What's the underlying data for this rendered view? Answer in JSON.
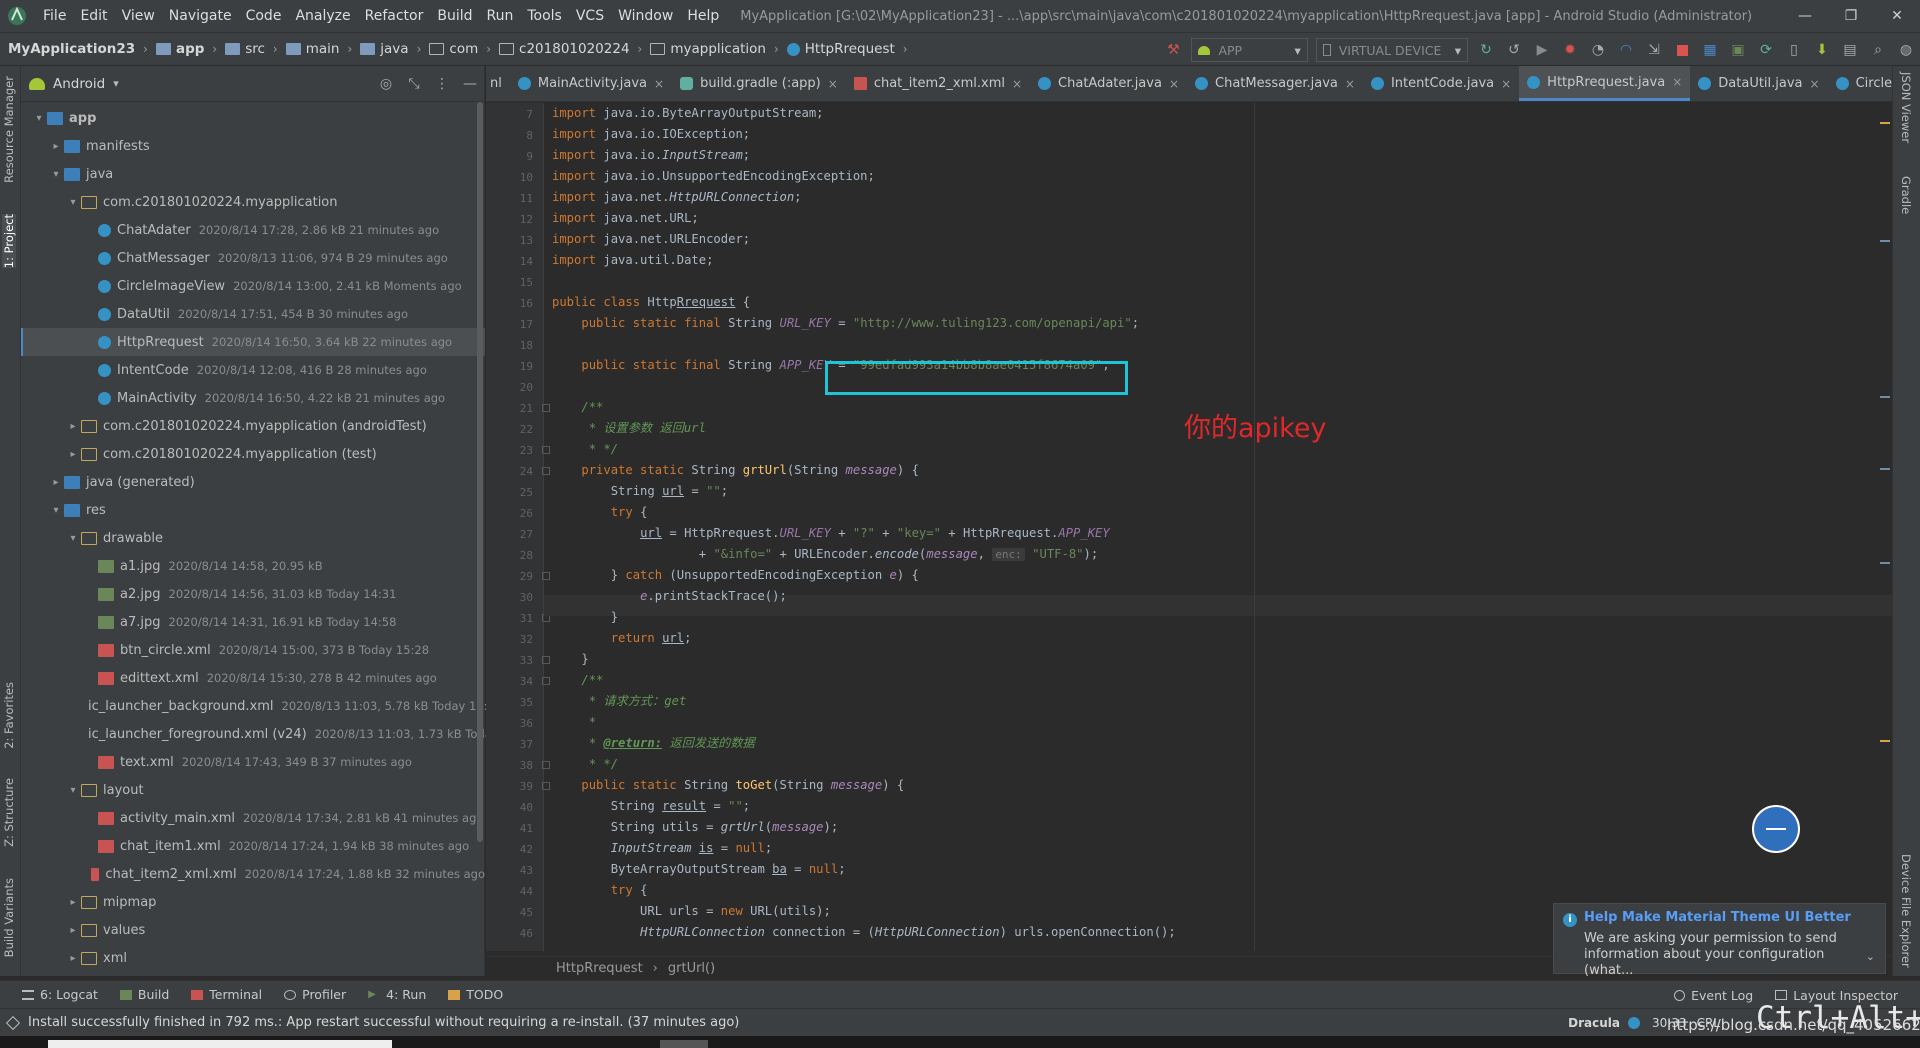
{
  "menubar": {
    "items": [
      "File",
      "Edit",
      "View",
      "Navigate",
      "Code",
      "Analyze",
      "Refactor",
      "Build",
      "Run",
      "Tools",
      "VCS",
      "Window",
      "Help"
    ],
    "title": "MyApplication [G:\\02\\MyApplication23] - ...\\app\\src\\main\\java\\com\\c201801020224\\myapplication\\HttpRrequest.java [app] - Android Studio (Administrator)",
    "minimize": "—",
    "maximize": "❐",
    "close": "✕"
  },
  "navbar": {
    "crumbs": [
      "MyApplication23",
      "app",
      "src",
      "main",
      "java",
      "com",
      "c201801020224",
      "myapplication",
      "HttpRrequest"
    ],
    "run_config": "APP",
    "device": "VIRTUAL DEVICE"
  },
  "left_stripe": {
    "resource_manager": "Resource Manager",
    "project": "1: Project",
    "favorites": "2: Favorites",
    "structure": "Z: Structure",
    "build_variants": "Build Variants"
  },
  "project_panel": {
    "view": "Android",
    "tree": [
      {
        "label": "app",
        "meta": "",
        "icon": "module",
        "depth": 0,
        "expand": "▾"
      },
      {
        "label": "manifests",
        "meta": "",
        "icon": "folder",
        "depth": 1,
        "expand": "▸"
      },
      {
        "label": "java",
        "meta": "",
        "icon": "folder",
        "depth": 1,
        "expand": "▾"
      },
      {
        "label": "com.c201801020224.myapplication",
        "meta": "",
        "icon": "package",
        "depth": 2,
        "expand": "▾"
      },
      {
        "label": "ChatAdater",
        "meta": "2020/8/14 17:28, 2.86 kB 21 minutes ago",
        "icon": "class",
        "depth": 3,
        "expand": ""
      },
      {
        "label": "ChatMessager",
        "meta": "2020/8/13 11:06, 974 B 29 minutes ago",
        "icon": "class",
        "depth": 3,
        "expand": ""
      },
      {
        "label": "CircleImageView",
        "meta": "2020/8/14 13:00, 2.41 kB Moments ago",
        "icon": "class",
        "depth": 3,
        "expand": ""
      },
      {
        "label": "DataUtil",
        "meta": "2020/8/14 17:51, 454 B 30 minutes ago",
        "icon": "class",
        "depth": 3,
        "expand": ""
      },
      {
        "label": "HttpRrequest",
        "meta": "2020/8/14 16:50, 3.64 kB 22 minutes ago",
        "icon": "class",
        "depth": 3,
        "expand": "",
        "selected": true
      },
      {
        "label": "IntentCode",
        "meta": "2020/8/14 12:08, 416 B 28 minutes ago",
        "icon": "class",
        "depth": 3,
        "expand": ""
      },
      {
        "label": "MainActivity",
        "meta": "2020/8/14 16:50, 4.22 kB 21 minutes ago",
        "icon": "class",
        "depth": 3,
        "expand": ""
      },
      {
        "label": "com.c201801020224.myapplication (androidTest)",
        "meta": "",
        "icon": "package",
        "depth": 2,
        "expand": "▸"
      },
      {
        "label": "com.c201801020224.myapplication (test)",
        "meta": "",
        "icon": "package",
        "depth": 2,
        "expand": "▸"
      },
      {
        "label": "java (generated)",
        "meta": "",
        "icon": "folder",
        "depth": 1,
        "expand": "▸"
      },
      {
        "label": "res",
        "meta": "",
        "icon": "folder",
        "depth": 1,
        "expand": "▾"
      },
      {
        "label": "drawable",
        "meta": "",
        "icon": "package",
        "depth": 2,
        "expand": "▾"
      },
      {
        "label": "a1.jpg",
        "meta": "2020/8/14 14:58, 20.95 kB",
        "icon": "image",
        "depth": 3,
        "expand": ""
      },
      {
        "label": "a2.jpg",
        "meta": "2020/8/14 14:56, 31.03 kB Today 14:31",
        "icon": "image",
        "depth": 3,
        "expand": ""
      },
      {
        "label": "a7.jpg",
        "meta": "2020/8/14 14:31, 16.91 kB Today 14:58",
        "icon": "image",
        "depth": 3,
        "expand": ""
      },
      {
        "label": "btn_circle.xml",
        "meta": "2020/8/14 15:00, 373 B Today 15:28",
        "icon": "xml",
        "depth": 3,
        "expand": ""
      },
      {
        "label": "edittext.xml",
        "meta": "2020/8/14 15:30, 278 B 42 minutes ago",
        "icon": "xml",
        "depth": 3,
        "expand": ""
      },
      {
        "label": "ic_launcher_background.xml",
        "meta": "2020/8/13 11:03, 5.78 kB Today 15:30",
        "icon": "xml",
        "depth": 3,
        "expand": ""
      },
      {
        "label": "ic_launcher_foreground.xml (v24)",
        "meta": "2020/8/13 11:03, 1.73 kB Today 14",
        "icon": "xml",
        "depth": 3,
        "expand": ""
      },
      {
        "label": "text.xml",
        "meta": "2020/8/14 17:43, 349 B 37 minutes ago",
        "icon": "xml",
        "depth": 3,
        "expand": ""
      },
      {
        "label": "layout",
        "meta": "",
        "icon": "package",
        "depth": 2,
        "expand": "▾"
      },
      {
        "label": "activity_main.xml",
        "meta": "2020/8/14 17:34, 2.81 kB 41 minutes ago",
        "icon": "xml",
        "depth": 3,
        "expand": ""
      },
      {
        "label": "chat_item1.xml",
        "meta": "2020/8/14 17:24, 1.94 kB 38 minutes ago",
        "icon": "xml",
        "depth": 3,
        "expand": ""
      },
      {
        "label": "chat_item2_xml.xml",
        "meta": "2020/8/14 17:24, 1.88 kB 32 minutes ago",
        "icon": "xml",
        "depth": 3,
        "expand": ""
      },
      {
        "label": "mipmap",
        "meta": "",
        "icon": "package",
        "depth": 2,
        "expand": "▸"
      },
      {
        "label": "values",
        "meta": "",
        "icon": "package",
        "depth": 2,
        "expand": "▸"
      },
      {
        "label": "xml",
        "meta": "",
        "icon": "package",
        "depth": 2,
        "expand": "▸"
      }
    ]
  },
  "tabs": [
    {
      "label": "nl",
      "icon": "",
      "active": false,
      "kind": "scroll"
    },
    {
      "label": "MainActivity.java",
      "icon": "class",
      "active": false
    },
    {
      "label": "build.gradle (:app)",
      "icon": "gradle",
      "active": false
    },
    {
      "label": "chat_item2_xml.xml",
      "icon": "xml",
      "active": false
    },
    {
      "label": "ChatAdater.java",
      "icon": "class",
      "active": false
    },
    {
      "label": "ChatMessager.java",
      "icon": "class",
      "active": false
    },
    {
      "label": "IntentCode.java",
      "icon": "class",
      "active": false
    },
    {
      "label": "HttpRrequest.java",
      "icon": "class",
      "active": true
    },
    {
      "label": "DataUtil.java",
      "icon": "class",
      "active": false
    },
    {
      "label": "CircleImageView.java",
      "icon": "class",
      "active": false
    }
  ],
  "editor": {
    "line_numbers": [
      "7",
      "8",
      "9",
      "10",
      "11",
      "12",
      "13",
      "14",
      "15",
      "16",
      "17",
      "18",
      "19",
      "20",
      "21",
      "22",
      "23",
      "24",
      "25",
      "26",
      "27",
      "28",
      "29",
      "30",
      "31",
      "32",
      "33",
      "34",
      "35",
      "36",
      "37",
      "38",
      "39",
      "40",
      "41",
      "42",
      "43",
      "44",
      "45",
      "46"
    ],
    "lines": [
      [
        [
          "kw",
          "import "
        ],
        [
          "p",
          "java.io.ByteArrayOutputStream;"
        ]
      ],
      [
        [
          "kw",
          "import "
        ],
        [
          "p",
          "java.io.IOException;"
        ]
      ],
      [
        [
          "kw",
          "import "
        ],
        [
          "p",
          "java.io."
        ],
        [
          "ital",
          "InputStream"
        ],
        [
          "p",
          ";"
        ]
      ],
      [
        [
          "kw",
          "import "
        ],
        [
          "p",
          "java.io.UnsupportedEncodingException;"
        ]
      ],
      [
        [
          "kw",
          "import "
        ],
        [
          "p",
          "java.net."
        ],
        [
          "ital",
          "HttpURLConnection"
        ],
        [
          "p",
          ";"
        ]
      ],
      [
        [
          "kw",
          "import "
        ],
        [
          "p",
          "java.net.URL;"
        ]
      ],
      [
        [
          "kw",
          "import "
        ],
        [
          "p",
          "java.net.URLEncoder;"
        ]
      ],
      [
        [
          "kw",
          "import "
        ],
        [
          "p",
          "java.util.Date;"
        ]
      ],
      [],
      [
        [
          "kw",
          "public class "
        ],
        [
          "p",
          "Http"
        ],
        [
          "ul",
          "Rrequest"
        ],
        [
          "p",
          " {"
        ]
      ],
      [
        [
          "p",
          "    "
        ],
        [
          "kw",
          "public static final "
        ],
        [
          "p",
          "String "
        ],
        [
          "fld",
          "URL_KEY"
        ],
        [
          "p",
          " = "
        ],
        [
          "str",
          "\"http://www.tuling123.com/openapi/api\""
        ],
        [
          "p",
          ";"
        ]
      ],
      [],
      [
        [
          "p",
          "    "
        ],
        [
          "kw",
          "public static final "
        ],
        [
          "p",
          "String "
        ],
        [
          "fld",
          "APP_KEY"
        ],
        [
          "p",
          " = "
        ],
        [
          "str",
          "\"99edfad993a14bb8b8ae0415f8674a09\""
        ],
        [
          "p",
          ";"
        ]
      ],
      [],
      [
        [
          "p",
          "    "
        ],
        [
          "cmt",
          "/**"
        ]
      ],
      [
        [
          "p",
          "    "
        ],
        [
          "cmt",
          " * 设置参数 返回url"
        ]
      ],
      [
        [
          "p",
          "    "
        ],
        [
          "cmt",
          " * */"
        ]
      ],
      [
        [
          "p",
          "    "
        ],
        [
          "kw",
          "private static "
        ],
        [
          "p",
          "String "
        ],
        [
          "fn",
          "grtUrl"
        ],
        [
          "p",
          "(String "
        ],
        [
          "param",
          "message"
        ],
        [
          "p",
          ") {"
        ]
      ],
      [
        [
          "p",
          "        String "
        ],
        [
          "ul",
          "url"
        ],
        [
          "p",
          " = "
        ],
        [
          "str",
          "\"\""
        ],
        [
          "p",
          ";"
        ]
      ],
      [
        [
          "p",
          "        "
        ],
        [
          "kw",
          "try "
        ],
        [
          "p",
          "{"
        ]
      ],
      [
        [
          "p",
          "            "
        ],
        [
          "ul",
          "url"
        ],
        [
          "p",
          " = HttpRrequest."
        ],
        [
          "fld",
          "URL_KEY"
        ],
        [
          "p",
          " + "
        ],
        [
          "str",
          "\"?\""
        ],
        [
          "p",
          " + "
        ],
        [
          "str",
          "\"key=\""
        ],
        [
          "p",
          " + HttpRrequest."
        ],
        [
          "fld",
          "APP_KEY"
        ]
      ],
      [
        [
          "p",
          "                    + "
        ],
        [
          "str",
          "\"&info=\""
        ],
        [
          "p",
          " + URLEncoder."
        ],
        [
          "ital",
          "encode"
        ],
        [
          "p",
          "("
        ],
        [
          "param",
          "message"
        ],
        [
          "p",
          ", "
        ],
        [
          "hint",
          "enc:"
        ],
        [
          "p",
          " "
        ],
        [
          "str",
          "\"UTF-8\""
        ],
        [
          "p",
          ");"
        ]
      ],
      [
        [
          "p",
          "        } "
        ],
        [
          "kw",
          "catch "
        ],
        [
          "p",
          "(UnsupportedEncodingException "
        ],
        [
          "param",
          "e"
        ],
        [
          "p",
          ") {"
        ]
      ],
      [
        [
          "p",
          "            "
        ],
        [
          "param",
          "e"
        ],
        [
          "p",
          ".printStackTrace();"
        ]
      ],
      [
        [
          "p",
          "        }"
        ]
      ],
      [
        [
          "p",
          "        "
        ],
        [
          "kw",
          "return "
        ],
        [
          "ul",
          "url"
        ],
        [
          "p",
          ";"
        ]
      ],
      [
        [
          "p",
          "    }"
        ]
      ],
      [
        [
          "p",
          "    "
        ],
        [
          "cmt",
          "/**"
        ]
      ],
      [
        [
          "p",
          "    "
        ],
        [
          "cmt",
          " * 请求方式：get"
        ]
      ],
      [
        [
          "p",
          "    "
        ],
        [
          "cmt",
          " *"
        ]
      ],
      [
        [
          "p",
          "    "
        ],
        [
          "cmt",
          " * "
        ],
        [
          "doctag",
          "@return:"
        ],
        [
          "cmt",
          " 返回发送的数据"
        ]
      ],
      [
        [
          "p",
          "    "
        ],
        [
          "cmt",
          " * */"
        ]
      ],
      [
        [
          "p",
          "    "
        ],
        [
          "kw",
          "public static "
        ],
        [
          "p",
          "String "
        ],
        [
          "fn",
          "toGet"
        ],
        [
          "p",
          "(String "
        ],
        [
          "param",
          "message"
        ],
        [
          "p",
          ") {"
        ]
      ],
      [
        [
          "p",
          "        String "
        ],
        [
          "ul",
          "result"
        ],
        [
          "p",
          " = "
        ],
        [
          "str",
          "\"\""
        ],
        [
          "p",
          ";"
        ]
      ],
      [
        [
          "p",
          "        String utils = "
        ],
        [
          "ital",
          "grtUrl"
        ],
        [
          "p",
          "("
        ],
        [
          "param",
          "message"
        ],
        [
          "p",
          ");"
        ]
      ],
      [
        [
          "p",
          "        "
        ],
        [
          "ital",
          "InputStream"
        ],
        [
          "p",
          " "
        ],
        [
          "ul",
          "is"
        ],
        [
          "p",
          " = "
        ],
        [
          "kw",
          "null"
        ],
        [
          "p",
          ";"
        ]
      ],
      [
        [
          "p",
          "        ByteArrayOutputStream "
        ],
        [
          "ul",
          "ba"
        ],
        [
          "p",
          " = "
        ],
        [
          "kw",
          "null"
        ],
        [
          "p",
          ";"
        ]
      ],
      [
        [
          "p",
          "        "
        ],
        [
          "kw",
          "try "
        ],
        [
          "p",
          "{"
        ]
      ],
      [
        [
          "p",
          "            URL urls = "
        ],
        [
          "kw",
          "new "
        ],
        [
          "p",
          "URL(utils);"
        ]
      ],
      [
        [
          "p",
          "            "
        ],
        [
          "ital",
          "HttpURLConnection"
        ],
        [
          "p",
          " connection = ("
        ],
        [
          "ital",
          "HttpURLConnection"
        ],
        [
          "p",
          ") urls.openConnection();"
        ]
      ]
    ],
    "annotation": "你的apikey"
  },
  "editor_breadcrumb": [
    "HttpRrequest",
    "grtUrl()"
  ],
  "right_stripe": {
    "json_viewer": "JSON Viewer",
    "gradle": "Gradle",
    "device_explorer": "Device File Explorer"
  },
  "notification": {
    "title": "Help Make Material Theme UI Better",
    "body": "We are asking your permission to send information about your configuration (what..."
  },
  "bottom_tabs": [
    "6: Logcat",
    "Build",
    "Terminal",
    "Profiler",
    "4: Run",
    "TODO"
  ],
  "bottom_right": [
    "Event Log",
    "Layout Inspector"
  ],
  "status": {
    "message": "Install successfully finished in 792 ms.: App restart successful without requiring a re-install. (37 minutes ago)",
    "theme": "Dracula",
    "position": "30:33",
    "encoding": "CRL"
  },
  "watermark": "https://blog.csdn.net/qq_40526628",
  "keys_overlay": "Ctrl+Alt+A",
  "colors": {
    "accent": "#4a88c7",
    "highlight_box": "#22c3d6",
    "annotation": "#e0282b"
  }
}
